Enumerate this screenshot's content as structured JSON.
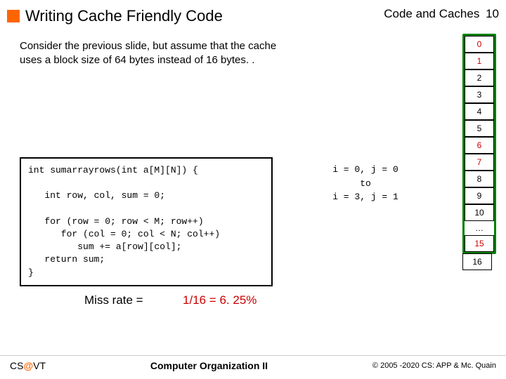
{
  "header": {
    "title": "Writing Cache Friendly Code",
    "topright": "Code and Caches",
    "page": "10"
  },
  "intro": "Consider the previous slide, but assume that the cache uses a block size of 64 bytes instead of 16 bytes. .",
  "code": "int sumarrayrows(int a[M][N]) {\n\n   int row, col, sum = 0;\n\n   for (row = 0; row < M; row++)\n      for (col = 0; col < N; col++)\n         sum += a[row][col];\n   return sum;\n}",
  "ij": {
    "line1": "i = 0, j = 0",
    "line2": "to",
    "line3": "i = 3, j = 1"
  },
  "miss": {
    "label": "Miss rate =",
    "value": "1/16 = 6. 25%"
  },
  "cache": {
    "rows": [
      "0",
      "1",
      "2",
      "3",
      "4",
      "5",
      "6",
      "7",
      "8",
      "9",
      "10",
      "…",
      "15"
    ],
    "below": "16"
  },
  "footer": {
    "cs": "CS",
    "at": "@",
    "vt": "VT",
    "title": "Computer Organization II",
    "copy": "© 2005 -2020 CS: APP & Mc. Quain"
  }
}
